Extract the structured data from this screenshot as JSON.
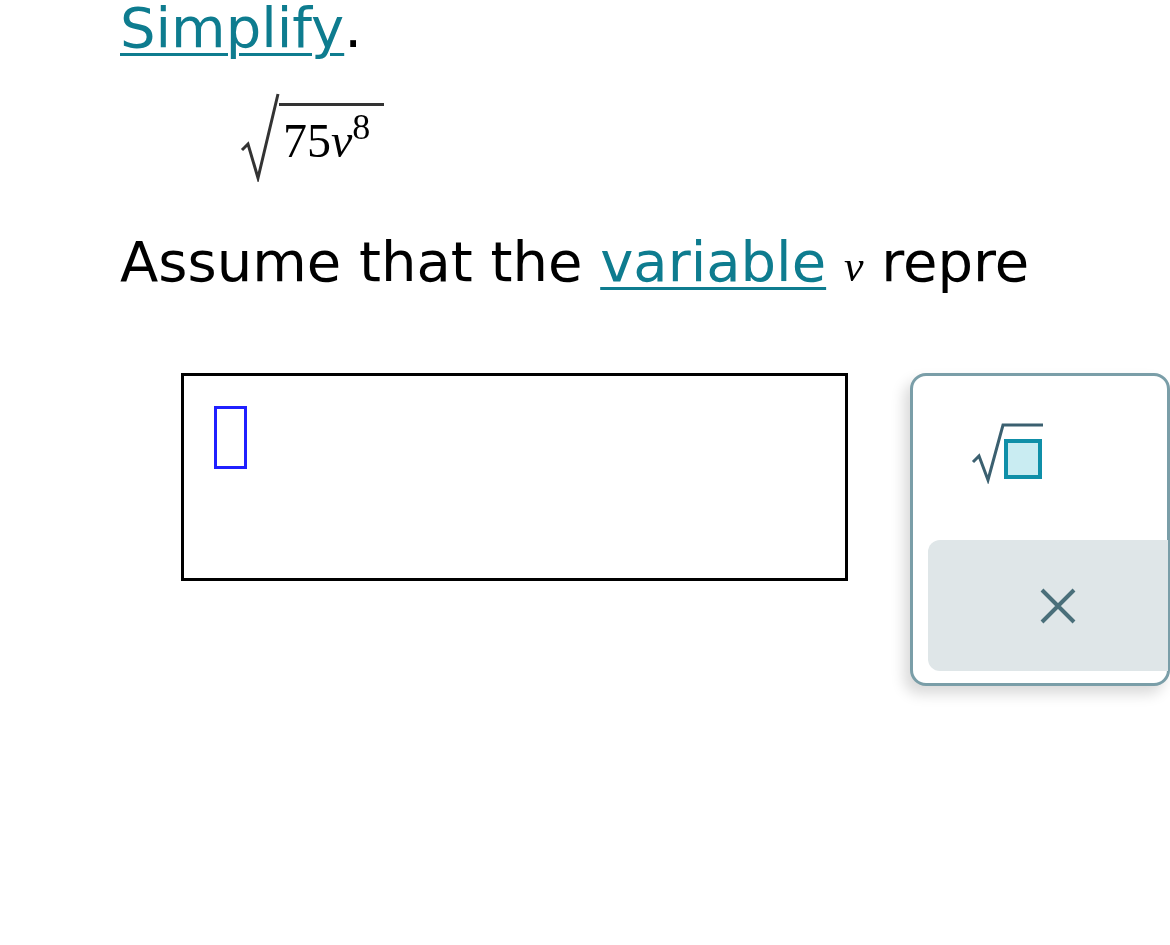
{
  "instruction": {
    "link": "Simplify",
    "punctuation": "."
  },
  "expression": {
    "coefficient": "75",
    "variable": "v",
    "exponent": "8"
  },
  "assumption": {
    "before": "Assume that the",
    "link": "variable",
    "variable": "v",
    "after": "repre"
  }
}
